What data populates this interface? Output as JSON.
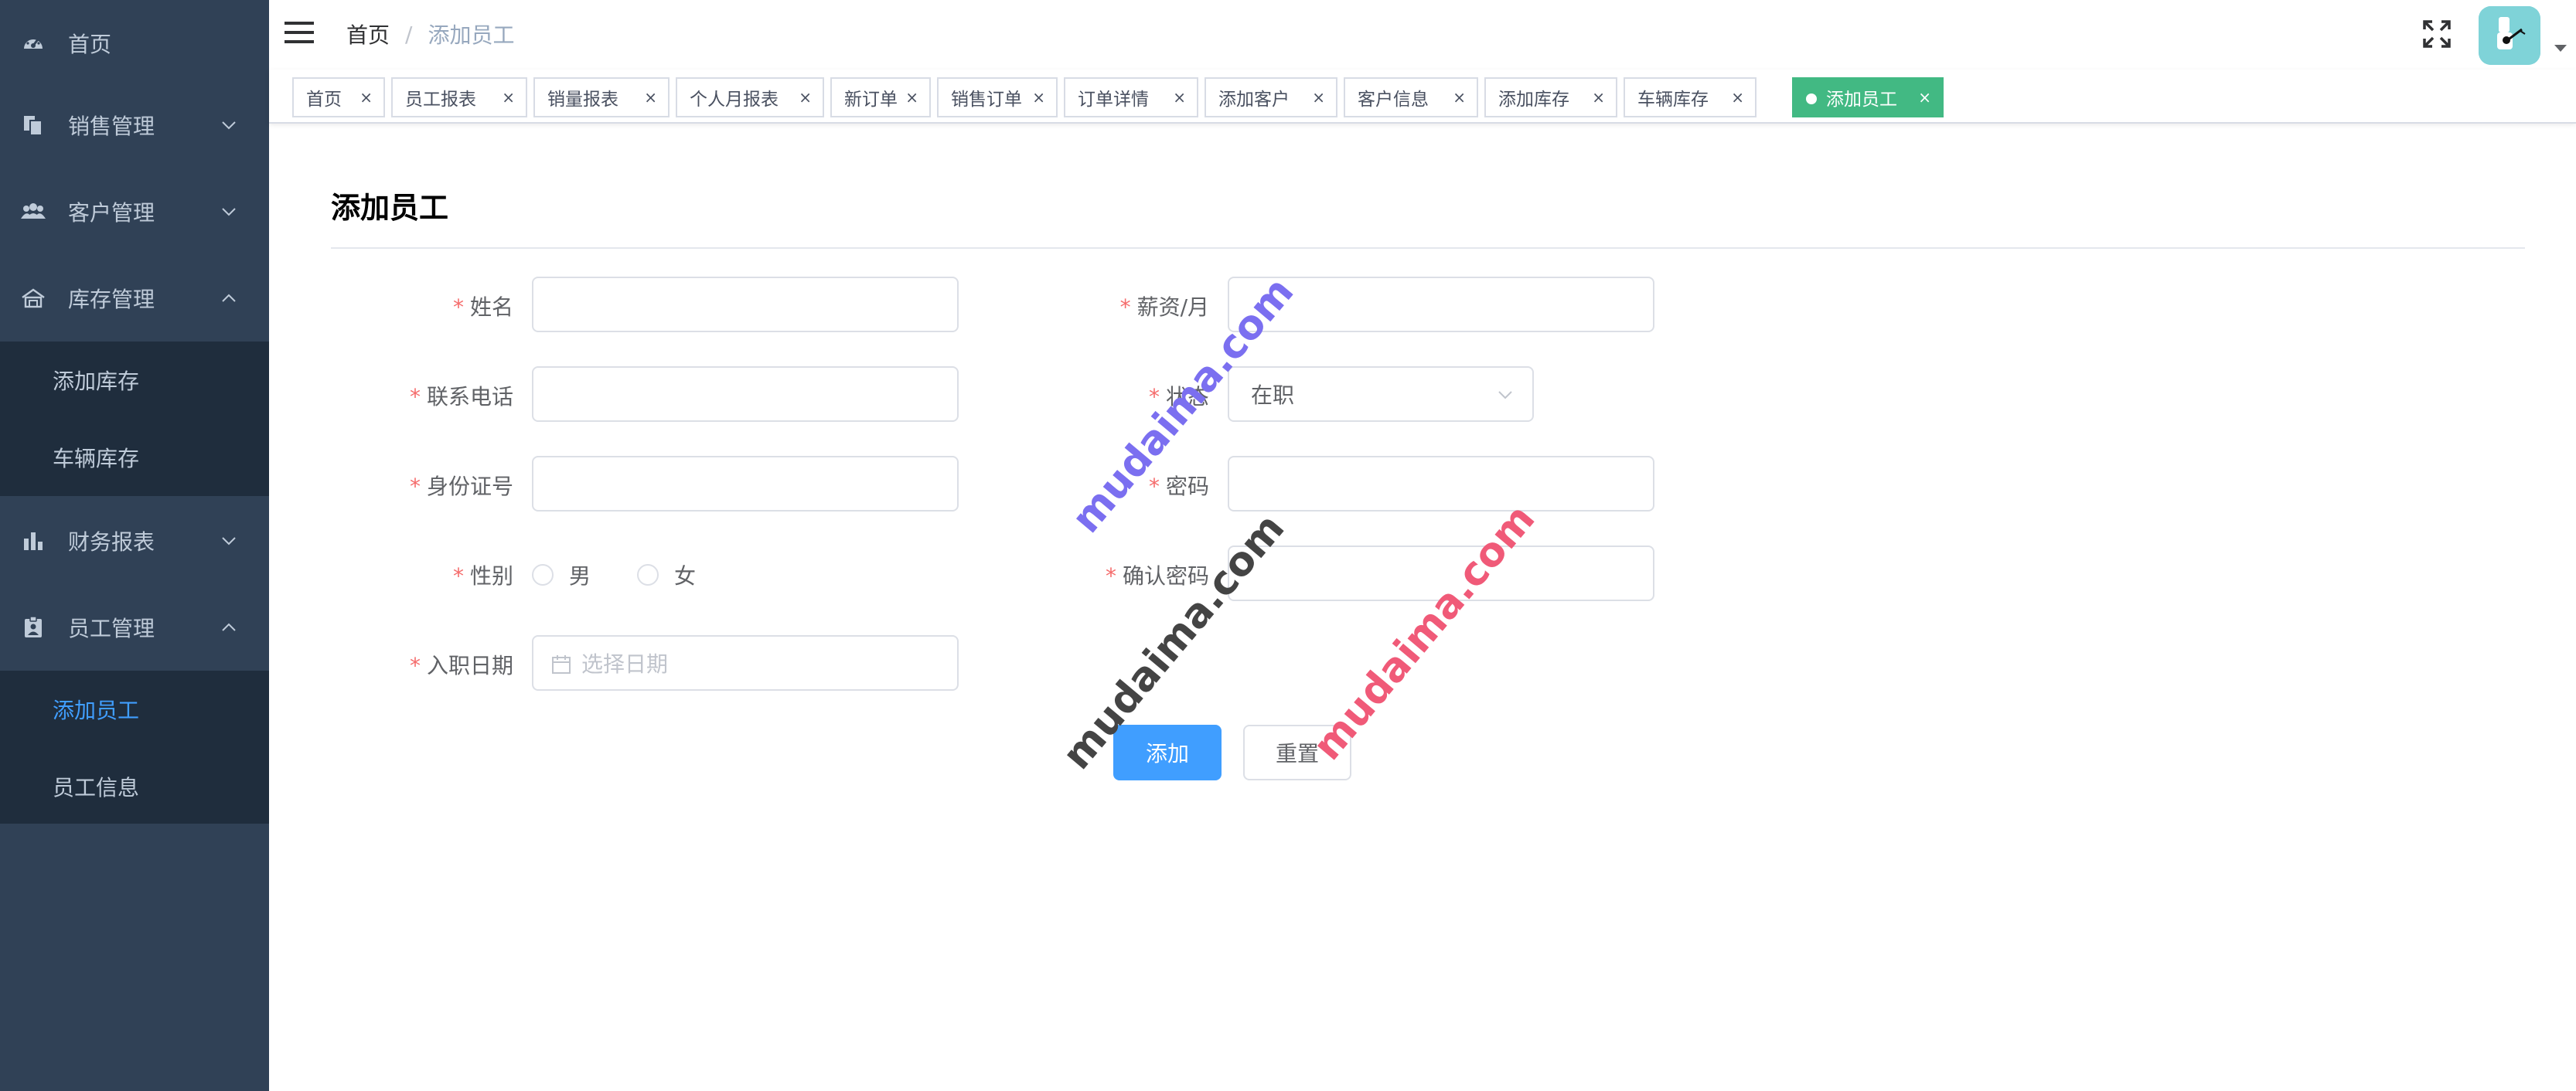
{
  "sidebar": {
    "items": [
      {
        "label": "首页",
        "icon": "dashboard-icon"
      },
      {
        "label": "销售管理",
        "icon": "documents-icon"
      },
      {
        "label": "客户管理",
        "icon": "peoples-icon"
      },
      {
        "label": "库存管理",
        "icon": "warehouse-icon",
        "expanded": true,
        "children": [
          {
            "label": "添加库存"
          },
          {
            "label": "车辆库存"
          }
        ]
      },
      {
        "label": "财务报表",
        "icon": "chart-icon"
      },
      {
        "label": "员工管理",
        "icon": "badge-icon",
        "expanded": true,
        "children": [
          {
            "label": "添加员工",
            "active": true
          },
          {
            "label": "员工信息"
          }
        ]
      }
    ]
  },
  "header": {
    "breadcrumb": {
      "home": "首页",
      "separator": "/",
      "current": "添加员工"
    }
  },
  "tags": [
    {
      "label": "首页"
    },
    {
      "label": "员工报表"
    },
    {
      "label": "销量报表"
    },
    {
      "label": "个人月报表"
    },
    {
      "label": "新订单"
    },
    {
      "label": "销售订单"
    },
    {
      "label": "订单详情"
    },
    {
      "label": "添加客户"
    },
    {
      "label": "客户信息"
    },
    {
      "label": "添加库存"
    },
    {
      "label": "车辆库存"
    },
    {
      "label": "添加员工",
      "active": true
    }
  ],
  "tag_close": "×",
  "form": {
    "title": "添加员工",
    "required_mark": "*",
    "name_label": "姓名",
    "name_value": "",
    "phone_label": "联系电话",
    "phone_value": "",
    "idcard_label": "身份证号",
    "idcard_value": "",
    "gender_label": "性别",
    "gender_options": [
      "男",
      "女"
    ],
    "hiredate_label": "入职日期",
    "hiredate_placeholder": "选择日期",
    "salary_label": "薪资/月",
    "salary_value": "",
    "status_label": "状态",
    "status_value": "在职",
    "password_label": "密码",
    "password_value": "",
    "confirm_label": "确认密码",
    "confirm_value": "",
    "submit_label": "添加",
    "reset_label": "重置"
  },
  "watermarks": [
    "mudaima.com",
    "mudaima.com",
    "mudaima.com"
  ],
  "colors": {
    "sidebar_bg": "#304156",
    "submenu_bg": "#1f2d3d",
    "active_menu": "#409eff",
    "active_tag": "#42b983",
    "primary": "#409eff",
    "required": "#f56c6c"
  }
}
